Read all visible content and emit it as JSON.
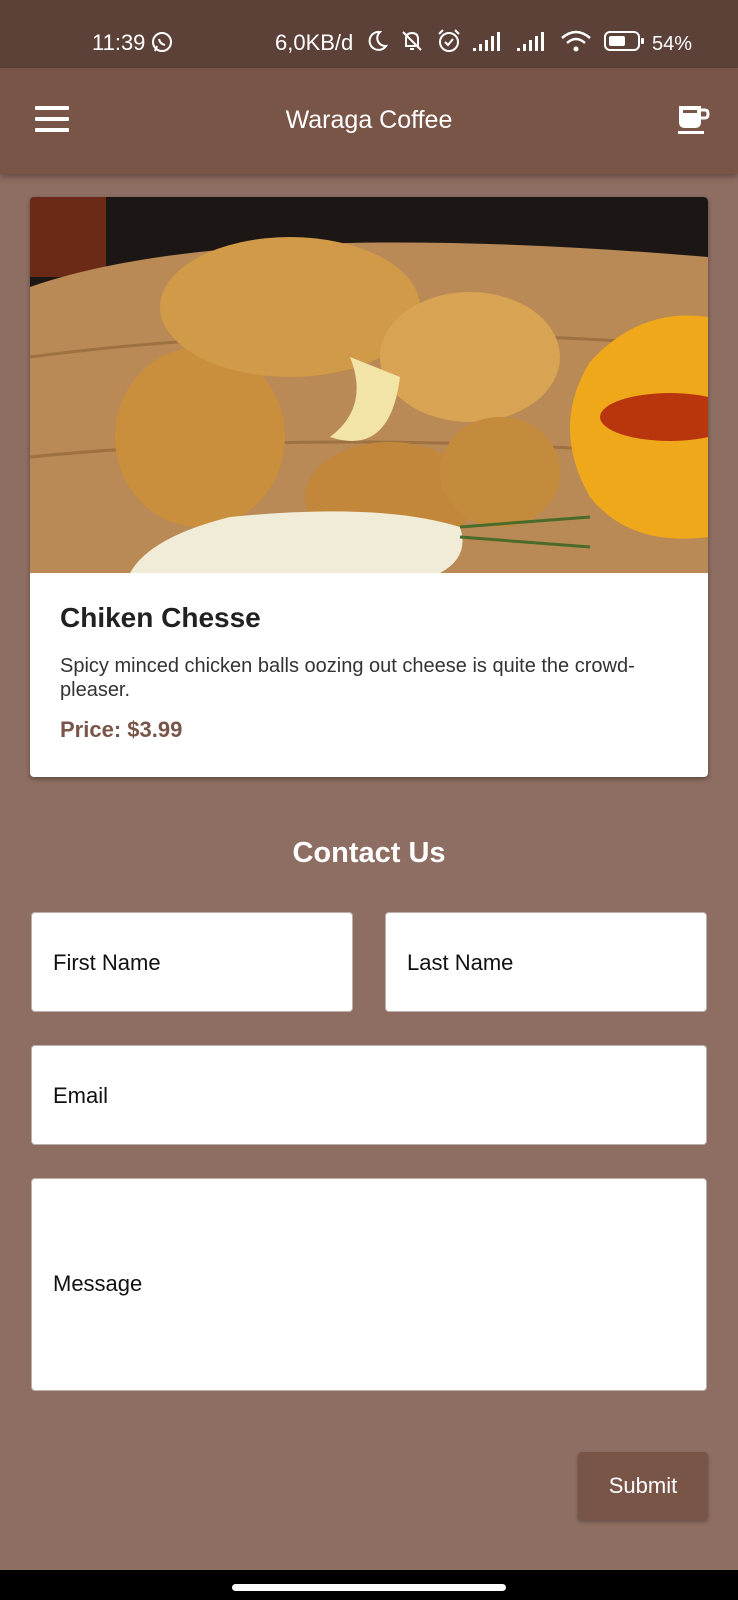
{
  "status_bar": {
    "time": "11:39",
    "network_speed": "6,0KB/d",
    "battery_level": "54%",
    "icons": [
      "whatsapp-icon",
      "moon-icon",
      "bell-off-icon",
      "alarm-icon",
      "signal-icon",
      "signal-icon",
      "wifi-icon",
      "battery-icon"
    ]
  },
  "app_bar": {
    "title": "Waraga Coffee",
    "left_icon": "menu-icon",
    "right_icon": "coffee-cup-icon"
  },
  "product": {
    "name": "Chiken Chesse",
    "description": "Spicy minced chicken balls oozing out cheese is quite the crowd-pleaser.",
    "price": "Price: $3.99"
  },
  "contact": {
    "title": "Contact Us",
    "first_name_placeholder": "First Name",
    "last_name_placeholder": "Last Name",
    "email_placeholder": "Email",
    "message_placeholder": "Message",
    "submit_label": "Submit"
  },
  "colors": {
    "status_bar": "#5c4138",
    "app_bar": "#795548",
    "background": "#8e6e63",
    "accent": "#795548"
  }
}
